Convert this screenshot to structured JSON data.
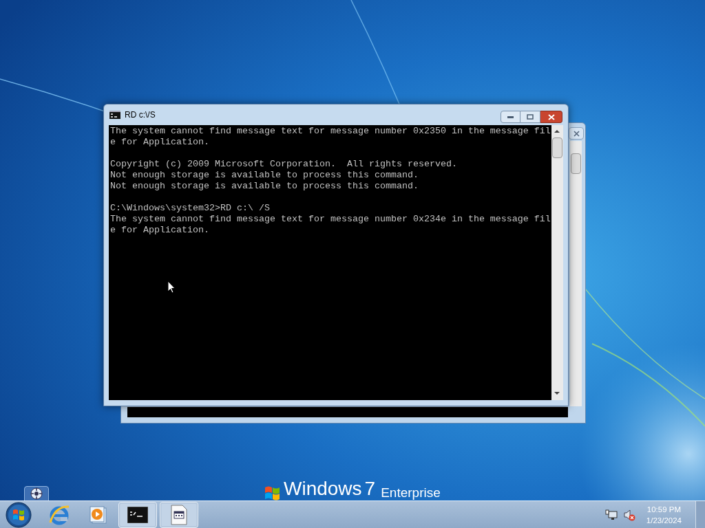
{
  "desktop": {
    "branding": {
      "name": "Windows",
      "version": "7",
      "edition": "Enterprise"
    }
  },
  "console_window": {
    "title": "RD c:\\/S",
    "active": true,
    "blocks": [
      [
        "The system cannot find message text for message number 0x2350 in the message fil",
        "e for Application."
      ],
      [
        "Copyright (c) 2009 Microsoft Corporation.  All rights reserved.",
        "Not enough storage is available to process this command.",
        "Not enough storage is available to process this command."
      ],
      [
        "C:\\Windows\\system32>RD c:\\ /S",
        "The system cannot find message text for message number 0x234e in the message fil",
        "e for Application."
      ]
    ]
  },
  "taskbar": {
    "items": [
      {
        "kind": "browser",
        "open": false
      },
      {
        "kind": "media",
        "open": false
      },
      {
        "kind": "console",
        "open": true
      },
      {
        "kind": "document",
        "open": true
      }
    ],
    "tray": {
      "volume_muted": true
    },
    "clock": {
      "time": "10:59 PM",
      "date": "1/23/2024"
    }
  }
}
